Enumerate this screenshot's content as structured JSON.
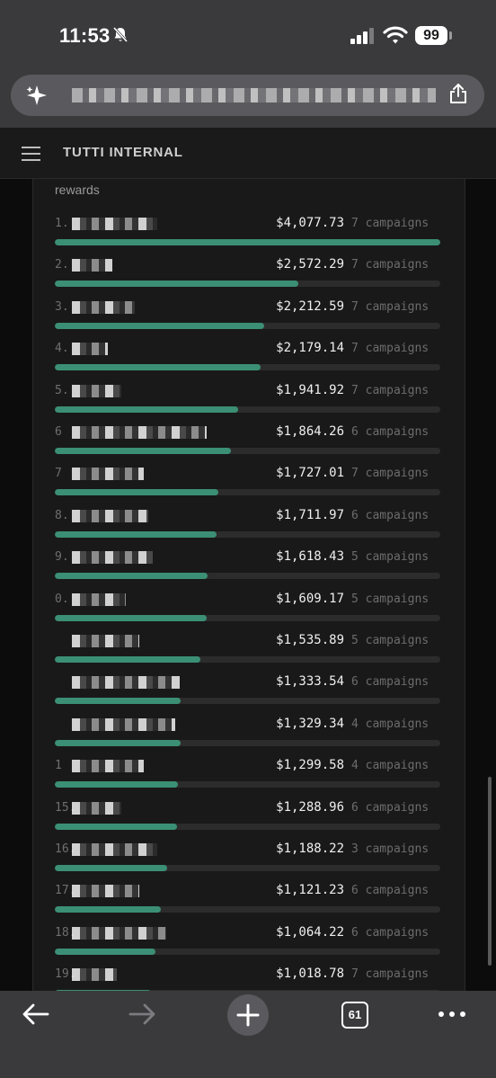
{
  "status_bar": {
    "time": "11:53",
    "battery": "99",
    "icons": [
      "bell-slash-icon",
      "signal-icon",
      "wifi-icon",
      "battery-icon"
    ]
  },
  "browser": {
    "url_icon": "sparkle-icon",
    "share_icon": "share-icon",
    "tabs_count": "61",
    "nav_icons": [
      "back-arrow-icon",
      "forward-arrow-icon",
      "plus-icon",
      "tabs-icon",
      "more-icon"
    ]
  },
  "header": {
    "menu_icon": "hamburger-menu-icon",
    "title": "TUTTI INTERNAL"
  },
  "leaderboard": {
    "section_label": "rewards",
    "rows": [
      {
        "rank": "1.",
        "amount": "$4,077.73",
        "campaigns": "7 campaigns",
        "progress": 1.0
      },
      {
        "rank": "2.",
        "amount": "$2,572.29",
        "campaigns": "7 campaigns",
        "progress": 0.631
      },
      {
        "rank": "3.",
        "amount": "$2,212.59",
        "campaigns": "7 campaigns",
        "progress": 0.543
      },
      {
        "rank": "4.",
        "amount": "$2,179.14",
        "campaigns": "7 campaigns",
        "progress": 0.534
      },
      {
        "rank": "5.",
        "amount": "$1,941.92",
        "campaigns": "7 campaigns",
        "progress": 0.476
      },
      {
        "rank": "6",
        "amount": "$1,864.26",
        "campaigns": "6 campaigns",
        "progress": 0.457
      },
      {
        "rank": "7",
        "amount": "$1,727.01",
        "campaigns": "7 campaigns",
        "progress": 0.424
      },
      {
        "rank": "8.",
        "amount": "$1,711.97",
        "campaigns": "6 campaigns",
        "progress": 0.42
      },
      {
        "rank": "9.",
        "amount": "$1,618.43",
        "campaigns": "5 campaigns",
        "progress": 0.397
      },
      {
        "rank": "0.",
        "amount": "$1,609.17",
        "campaigns": "5 campaigns",
        "progress": 0.395
      },
      {
        "rank": "",
        "amount": "$1,535.89",
        "campaigns": "5 campaigns",
        "progress": 0.377
      },
      {
        "rank": "",
        "amount": "$1,333.54",
        "campaigns": "6 campaigns",
        "progress": 0.327
      },
      {
        "rank": "",
        "amount": "$1,329.34",
        "campaigns": "4 campaigns",
        "progress": 0.326
      },
      {
        "rank": "1",
        "amount": "$1,299.58",
        "campaigns": "4 campaigns",
        "progress": 0.319
      },
      {
        "rank": "15.",
        "amount": "$1,288.96",
        "campaigns": "6 campaigns",
        "progress": 0.316
      },
      {
        "rank": "16.",
        "amount": "$1,188.22",
        "campaigns": "3 campaigns",
        "progress": 0.291
      },
      {
        "rank": "17.",
        "amount": "$1,121.23",
        "campaigns": "6 campaigns",
        "progress": 0.275
      },
      {
        "rank": "18.",
        "amount": "$1,064.22",
        "campaigns": "6 campaigns",
        "progress": 0.261
      },
      {
        "rank": "19.",
        "amount": "$1,018.78",
        "campaigns": "7 campaigns",
        "progress": 0.25
      }
    ]
  },
  "colors": {
    "bar_fill": "#3b8f74",
    "bar_track": "#2c2c2c",
    "panel": "#191919",
    "chrome": "#3a3a3c"
  }
}
